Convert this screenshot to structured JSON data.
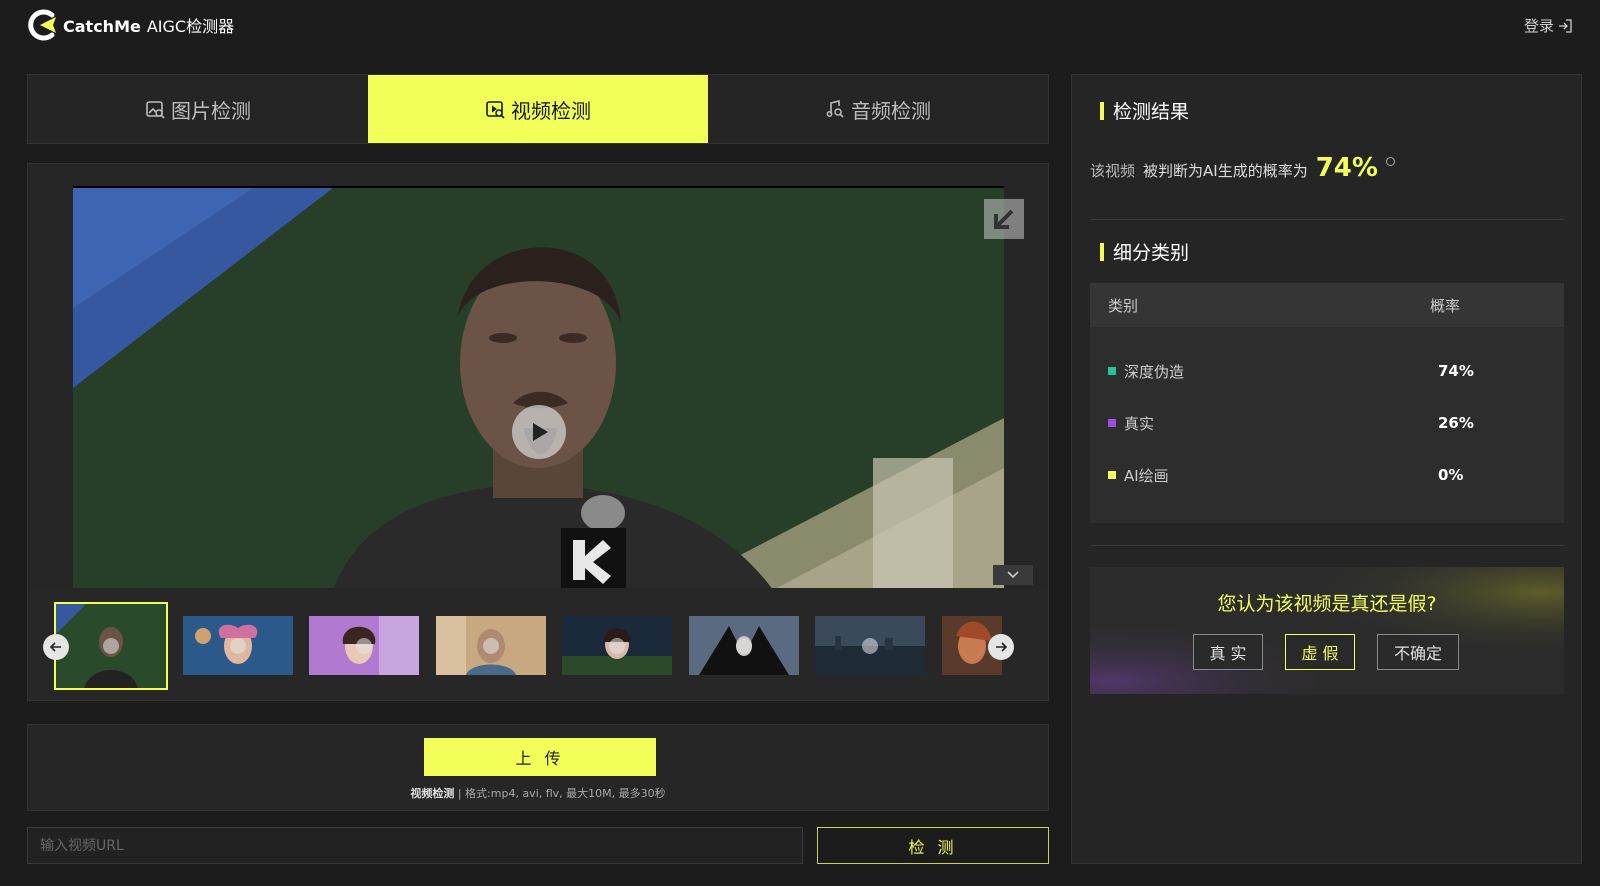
{
  "header": {
    "brand": "CatchMe",
    "product": "AIGC检测器",
    "login_label": "登录"
  },
  "tabs": [
    {
      "label": "图片检测",
      "icon": "image-search-icon",
      "active": false
    },
    {
      "label": "视频检测",
      "icon": "video-search-icon",
      "active": true
    },
    {
      "label": "音频检测",
      "icon": "music-search-icon",
      "active": false
    }
  ],
  "player": {
    "selected_thumbnail": 1,
    "thumbnail_count": 8
  },
  "upload": {
    "button_label": "上 传",
    "hint_bold": "视频检测",
    "hint_text": "| 格式:mp4, avi, flv, 最大10M, 最多30秒"
  },
  "url": {
    "placeholder": "输入视频URL",
    "detect_label": "检 测"
  },
  "result": {
    "title": "检测结果",
    "verdict_prefix": "该视频",
    "verdict_text": "被判断为AI生成的概率为",
    "verdict_pct": "74%",
    "breakdown_title": "细分类别",
    "table_header": {
      "category": "类别",
      "probability": "概率"
    },
    "categories": [
      {
        "name": "深度伪造",
        "value": "74%",
        "color": "#26c2a0"
      },
      {
        "name": "真实",
        "value": "26%",
        "color": "#9a4fe0"
      },
      {
        "name": "AI绘画",
        "value": "0%",
        "color": "#f2ff59"
      }
    ]
  },
  "vote": {
    "question": "您认为该视频是真还是假?",
    "options": [
      {
        "label": "真 实",
        "selected": false
      },
      {
        "label": "虚 假",
        "selected": true
      },
      {
        "label": "不确定",
        "selected": false
      }
    ]
  },
  "colors": {
    "accent": "#f2ff59",
    "background": "#1c1c1c",
    "panel": "#262626"
  }
}
